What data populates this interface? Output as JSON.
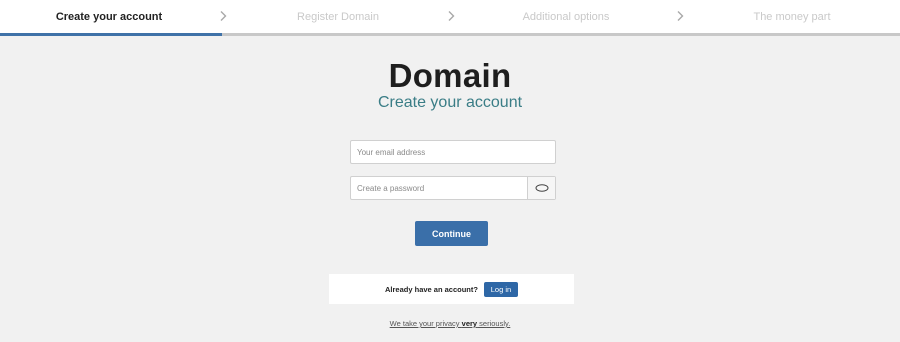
{
  "stepper": {
    "steps": [
      {
        "label": "Create your account",
        "active": true
      },
      {
        "label": "Register Domain",
        "active": false
      },
      {
        "label": "Additional options",
        "active": false
      },
      {
        "label": "The money part",
        "active": false
      }
    ],
    "progress_fraction": 0.247,
    "colors": {
      "progress": "#3f72a8",
      "track": "#c8c8c8"
    }
  },
  "brand": {
    "title": "Domain",
    "subtitle": "Create your account",
    "subtitle_color": "#3a7d86"
  },
  "form": {
    "email": {
      "placeholder": "Your email address",
      "value": ""
    },
    "password": {
      "placeholder": "Create a password",
      "value": "",
      "toggle_icon": "eye-icon"
    },
    "continue_label": "Continue",
    "button_color": "#3a6fa9"
  },
  "login": {
    "prompt": "Already have an account?",
    "button_label": "Log in"
  },
  "privacy": {
    "before": "We take your privacy ",
    "emphasis": "very",
    "after": " seriously."
  }
}
